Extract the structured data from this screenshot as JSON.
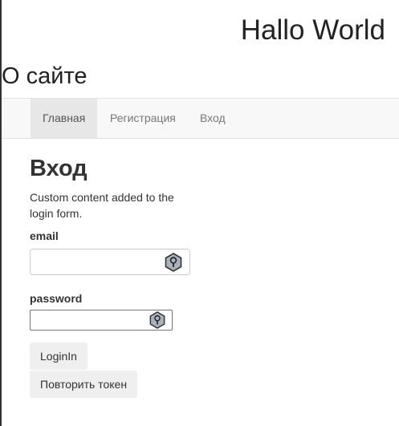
{
  "header": {
    "title": "Hallo World"
  },
  "about": {
    "text": "О сайте"
  },
  "nav": {
    "items": [
      {
        "label": "Главная",
        "active": true
      },
      {
        "label": "Регистрация",
        "active": false
      },
      {
        "label": "Вход",
        "active": false
      }
    ]
  },
  "main": {
    "title": "Вход",
    "custom_text": "Custom content added to the login form.",
    "email_label": "email",
    "email_value": "",
    "password_label": "password",
    "password_value": "",
    "login_button": "LoginIn",
    "retry_button": "Повторить токен"
  },
  "colors": {
    "navbar_bg": "#f8f8f8",
    "nav_active_bg": "#e7e7e7",
    "button_bg": "#efefef",
    "key_icon_fill": "#aab3bd"
  },
  "icons": {
    "email_field_icon": "key-icon",
    "password_field_icon": "key-icon"
  }
}
